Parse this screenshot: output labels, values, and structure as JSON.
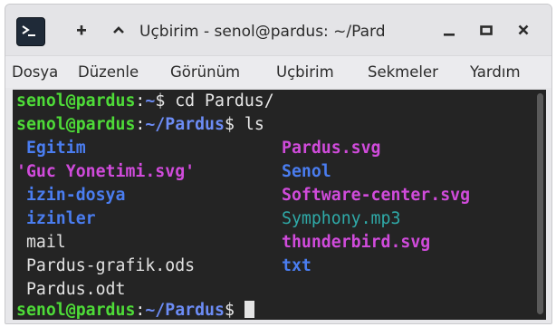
{
  "window": {
    "title": "Uçbirim - senol@pardus: ~/Pard"
  },
  "titlebar": {
    "icons": [
      "terminal-app-icon",
      "new-tab-plus-icon",
      "chevron-up-icon",
      "minimize-icon",
      "maximize-icon",
      "close-icon"
    ]
  },
  "menubar": {
    "items": [
      "Dosya",
      "Düzenle",
      "Görünüm",
      "Uçbirim",
      "Sekmeler",
      "Yardım"
    ]
  },
  "terminal": {
    "lines": [
      {
        "user": "senol@pardus",
        "sep": ":",
        "path": "~",
        "rest": "$ cd Pardus/"
      },
      {
        "user": "senol@pardus",
        "sep": ":",
        "path": "~/Pardus",
        "rest": "$ ls"
      }
    ],
    "ls_col1": [
      {
        "text": " Egitim",
        "type": "dir"
      },
      {
        "text": "'Guc Yonetimi.svg'",
        "type": "img"
      },
      {
        "text": " izin-dosya",
        "type": "dir"
      },
      {
        "text": " izinler",
        "type": "dir"
      },
      {
        "text": " mail",
        "type": "plain"
      },
      {
        "text": " Pardus-grafik.ods",
        "type": "plain"
      },
      {
        "text": " Pardus.odt",
        "type": "plain"
      }
    ],
    "ls_col2": [
      {
        "text": "Pardus.svg",
        "type": "img"
      },
      {
        "text": "Senol",
        "type": "dir"
      },
      {
        "text": "Software-center.svg",
        "type": "img"
      },
      {
        "text": "Symphony.mp3",
        "type": "audio"
      },
      {
        "text": "thunderbird.svg",
        "type": "img"
      },
      {
        "text": "txt",
        "type": "dir"
      }
    ],
    "prompt": {
      "user": "senol@pardus",
      "sep": ":",
      "path": "~/Pardus",
      "rest": "$ "
    }
  },
  "colors": {
    "terminal_bg": "#242424",
    "user": "#4edb38",
    "path": "#6c8cf5",
    "dir": "#4a7df0",
    "img": "#d04bdb",
    "audio": "#2faaa8"
  }
}
